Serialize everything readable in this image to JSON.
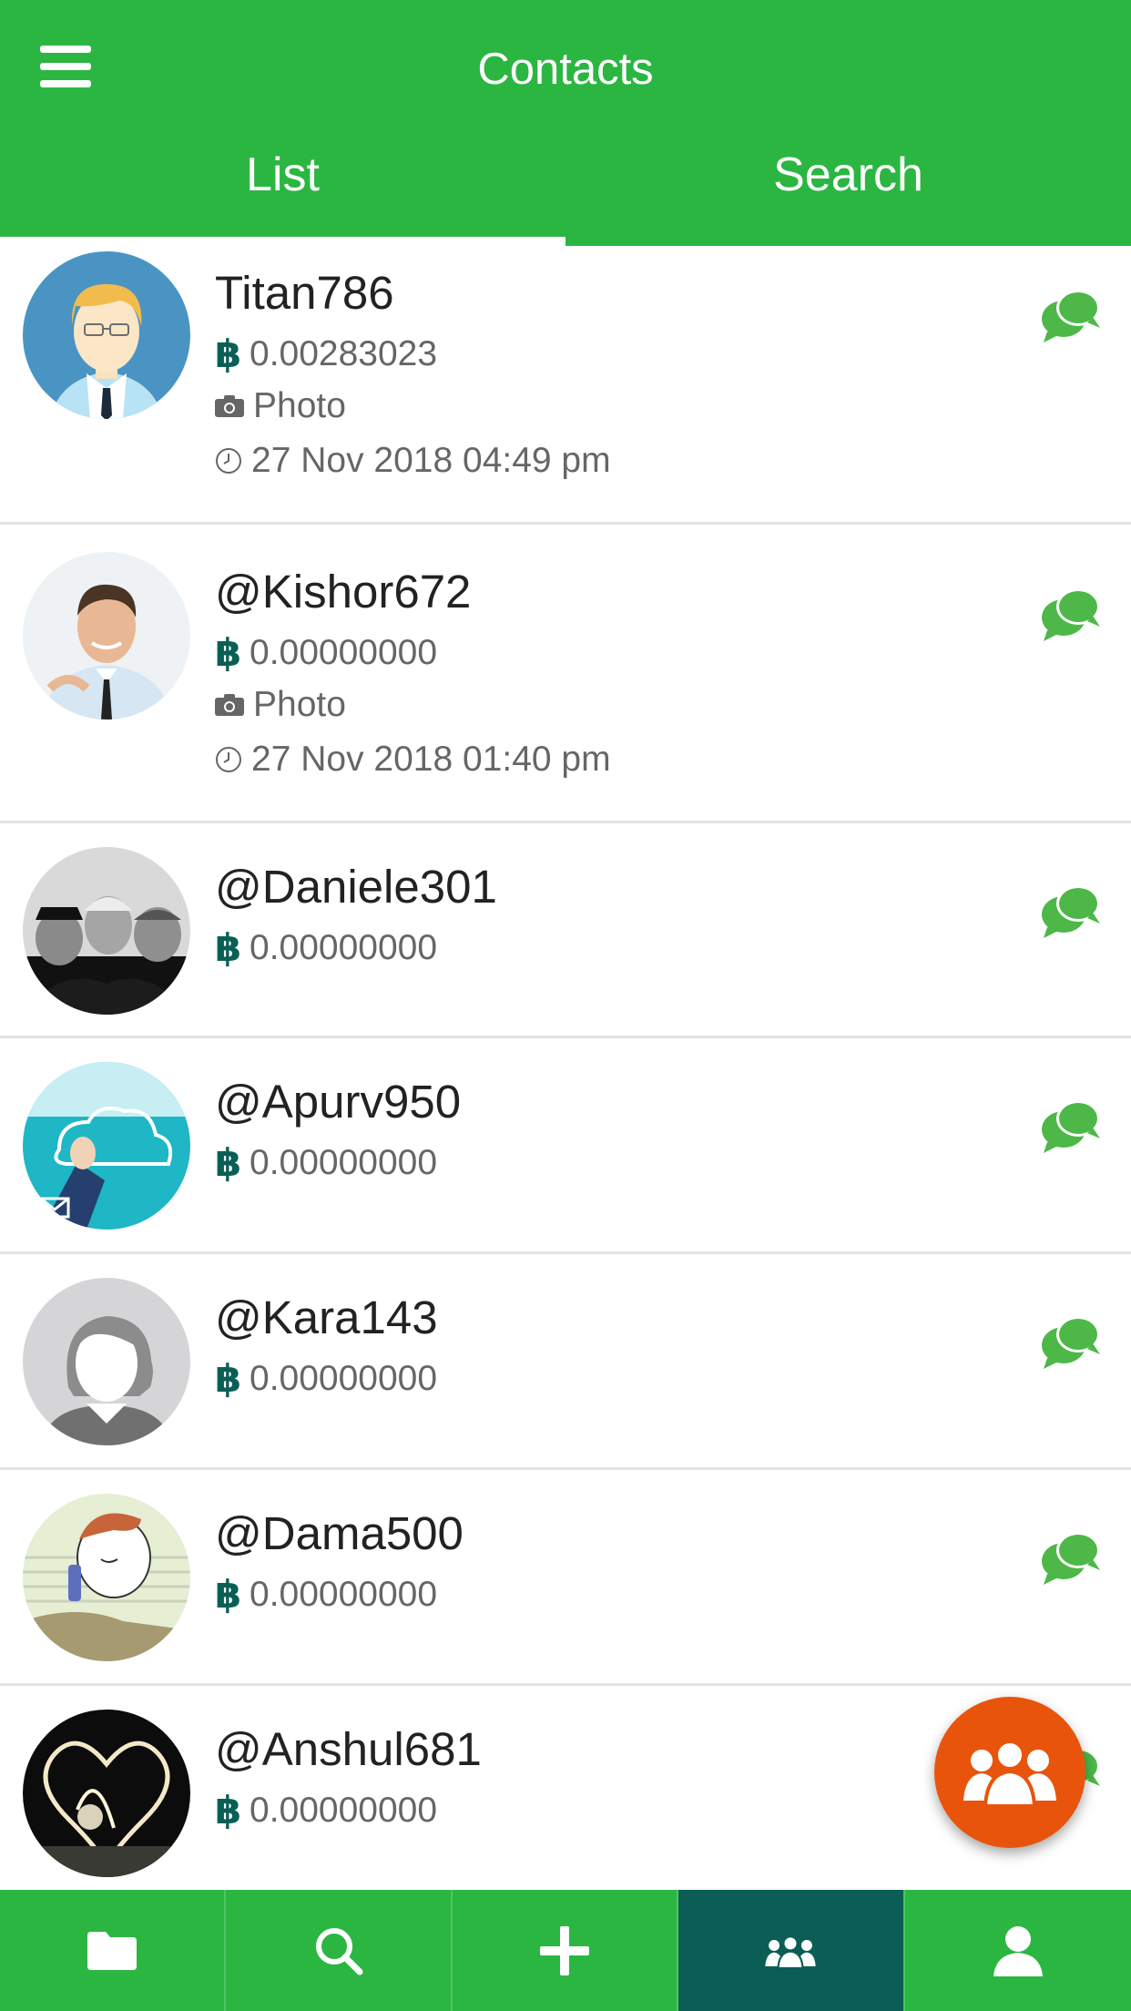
{
  "header": {
    "title": "Contacts",
    "tabs": [
      {
        "label": "List",
        "active": true
      },
      {
        "label": "Search",
        "active": false
      }
    ]
  },
  "colors": {
    "primary_green": "#2bb642",
    "active_nav": "#0b5e55",
    "fab_orange": "#e9540d",
    "chat_green": "#4db848",
    "btc_teal": "#0a5f55"
  },
  "currency_symbol": "฿",
  "contacts": [
    {
      "name": "Titan786",
      "balance": "0.00283023",
      "last_message": "Photo",
      "timestamp": "27 Nov 2018 04:49 pm"
    },
    {
      "name": "@Kishor672",
      "balance": "0.00000000",
      "last_message": "Photo",
      "timestamp": "27 Nov 2018 01:40 pm"
    },
    {
      "name": "@Daniele301",
      "balance": "0.00000000"
    },
    {
      "name": "@Apurv950",
      "balance": "0.00000000"
    },
    {
      "name": "@Kara143",
      "balance": "0.00000000"
    },
    {
      "name": "@Dama500",
      "balance": "0.00000000"
    },
    {
      "name": "@Anshul681",
      "balance": "0.00000000"
    }
  ],
  "icons": {
    "menu": "hamburger-icon",
    "chat": "chat-bubbles-icon",
    "camera": "camera-icon",
    "clock": "clock-icon",
    "fab": "group-icon"
  },
  "bottom_nav": [
    {
      "icon": "folder-icon",
      "active": false
    },
    {
      "icon": "search-icon",
      "active": false
    },
    {
      "icon": "plus-icon",
      "active": false
    },
    {
      "icon": "group-icon",
      "active": true
    },
    {
      "icon": "user-icon",
      "active": false
    }
  ]
}
